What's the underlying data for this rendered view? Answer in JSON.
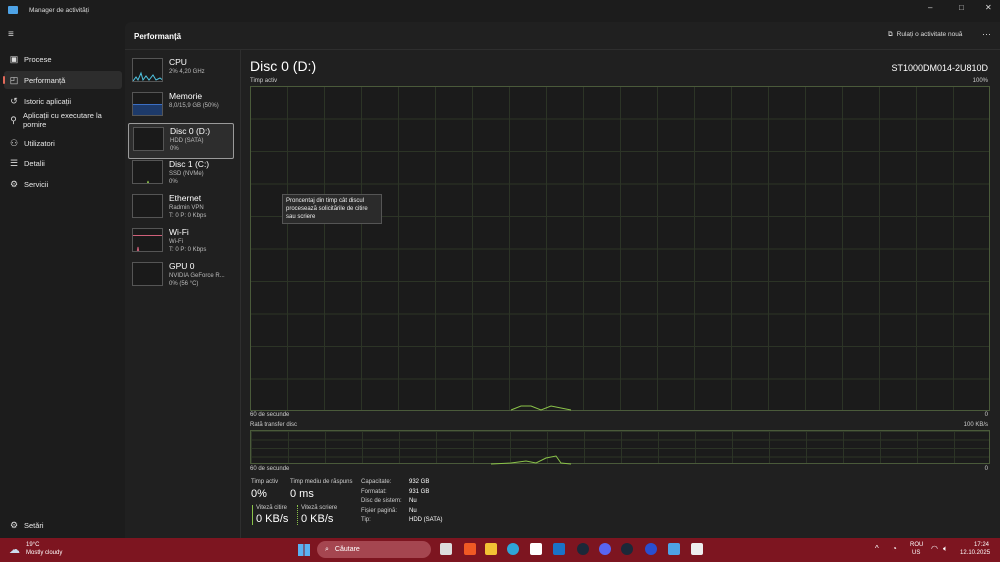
{
  "window": {
    "title": "Manager de activități",
    "minimize": "–",
    "maximize": "□",
    "close": "✕"
  },
  "nav": {
    "items": [
      {
        "label": "Procese",
        "icon": "processes-icon",
        "glyph": "▣"
      },
      {
        "label": "Performanță",
        "icon": "performance-icon",
        "glyph": "◰"
      },
      {
        "label": "Istoric aplicații",
        "icon": "history-icon",
        "glyph": "↺"
      },
      {
        "label": "Aplicații cu executare la pornire",
        "icon": "startup-icon",
        "glyph": "⚲"
      },
      {
        "label": "Utilizatori",
        "icon": "users-icon",
        "glyph": "⚇"
      },
      {
        "label": "Detalii",
        "icon": "details-icon",
        "glyph": "☰"
      },
      {
        "label": "Servicii",
        "icon": "services-icon",
        "glyph": "⚙"
      }
    ],
    "settings": "Setări"
  },
  "header": {
    "title": "Performanță",
    "run_task": "Rulați o activitate nouă",
    "more": "···"
  },
  "devices": [
    {
      "name": "CPU",
      "s1": "2% 4,20 GHz",
      "s2": "",
      "color": "#4fc3e0"
    },
    {
      "name": "Memorie",
      "s1": "8,0/15,9 GB (50%)",
      "s2": "",
      "color": "#3b6fc4"
    },
    {
      "name": "Disc 0 (D:)",
      "s1": "HDD (SATA)",
      "s2": "0%",
      "color": "#8bc34a"
    },
    {
      "name": "Disc 1 (C:)",
      "s1": "SSD (NVMe)",
      "s2": "0%",
      "color": "#8bc34a"
    },
    {
      "name": "Ethernet",
      "s1": "Radmin VPN",
      "s2": "T: 0 P: 0 Kbps",
      "color": "#c28a3a"
    },
    {
      "name": "Wi-Fi",
      "s1": "Wi-Fi",
      "s2": "T: 0 P: 0 Kbps",
      "color": "#d0607a"
    },
    {
      "name": "GPU 0",
      "s1": "NVIDIA GeForce R...",
      "s2": "0% (56 °C)",
      "color": "#b050c0"
    }
  ],
  "main": {
    "title": "Disc 0 (D:)",
    "model": "ST1000DM014-2U810D",
    "chart1": {
      "label": "Timp activ",
      "max": "100%",
      "xlabel": "60 de secunde",
      "min": "0"
    },
    "tooltip": "Proncentaj din timp cât discul procesează solicitările de citire sau scriere",
    "chart2": {
      "label": "Rată transfer disc",
      "max": "100 KB/s",
      "xlabel": "60 de secunde",
      "min": "0"
    },
    "stats": {
      "active_label": "Timp activ",
      "active": "0%",
      "resp_label": "Timp mediu de răspuns",
      "resp": "0 ms",
      "read_label": "Viteză citire",
      "read": "0 KB/s",
      "write_label": "Viteză scriere",
      "write": "0 KB/s"
    },
    "props": [
      [
        "Capacitate:",
        "932 GB"
      ],
      [
        "Formatat:",
        "931 GB"
      ],
      [
        "Disc de sistem:",
        "Nu"
      ],
      [
        "Fișier pagină:",
        "Nu"
      ],
      [
        "Tip:",
        "HDD (SATA)"
      ]
    ]
  },
  "taskbar": {
    "temp": "19°C",
    "weather": "Mostly cloudy",
    "search": "Căutare",
    "lang1": "ROU",
    "lang2": "US",
    "time": "17:24",
    "date": "12.10.2025"
  }
}
